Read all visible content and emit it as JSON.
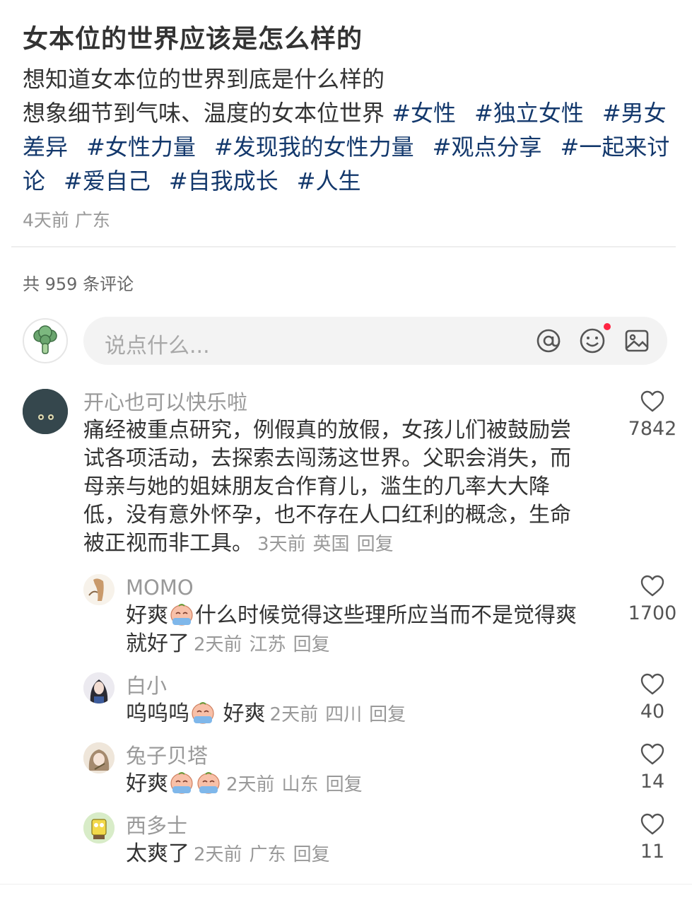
{
  "post": {
    "title": "女本位的世界应该是怎么样的",
    "line1": "想知道女本位的世界到底是什么样的",
    "line2": "想象细节到气味、温度的女本位世界",
    "tags": [
      "#女性",
      "#独立女性",
      "#男女差异",
      "#女性力量",
      "#发现我的女性力量",
      "#观点分享",
      "#一起来讨论",
      "#爱自己",
      "#自我成长",
      "#人生"
    ],
    "time": "4天前",
    "location": "广东"
  },
  "comments_header": {
    "count_text": "共 959 条评论"
  },
  "input": {
    "placeholder": "说点什么...",
    "icons": [
      "at-icon",
      "emoji-icon",
      "image-icon"
    ]
  },
  "comments": [
    {
      "name": "开心也可以快乐啦",
      "text_lines": [
        "痛经被重点研究，例假真的放假，女孩儿们被鼓励尝",
        "试各项活动，去探索去闯荡这世界。父职会消失，而",
        "母亲与她的姐妹朋友合作育儿，滥生的几率大大降",
        "低，没有意外怀孕，也不存在人口红利的概念，生命",
        "被正视而非工具。"
      ],
      "time": "3天前",
      "location": "英国",
      "reply": "回复",
      "likes": "7842"
    },
    {
      "name": "MOMO",
      "text_a": "好爽",
      "text_b": "什么时候觉得这些理所应当而不是觉得爽",
      "text_c": "就好了",
      "time": "2天前",
      "location": "江苏",
      "reply": "回复",
      "likes": "1700"
    },
    {
      "name": "白小",
      "text_a": "呜呜呜",
      "text_b": " 好爽",
      "time": "2天前",
      "location": "四川",
      "reply": "回复",
      "likes": "40"
    },
    {
      "name": "兔子贝塔",
      "text_a": "好爽",
      "time": "2天前",
      "location": "山东",
      "reply": "回复",
      "likes": "14"
    },
    {
      "name": "西多士",
      "text_a": "太爽了",
      "time": "2天前",
      "location": "广东",
      "reply": "回复",
      "likes": "11"
    }
  ],
  "colors": {
    "tag": "#13386c",
    "meta": "#999999",
    "text": "#333333",
    "dot": "#ff2442"
  }
}
